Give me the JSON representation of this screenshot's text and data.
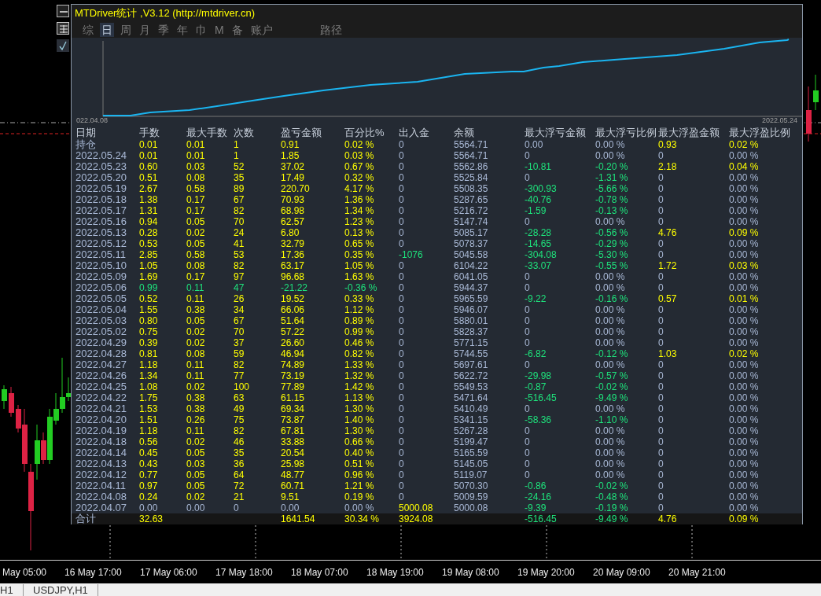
{
  "window": {
    "title": "MTDriver统计 ,V3.12 (http://mtdriver.cn)"
  },
  "tabs": [
    {
      "label": "综",
      "selected": false
    },
    {
      "label": "日",
      "selected": true
    },
    {
      "label": "周",
      "selected": false
    },
    {
      "label": "月",
      "selected": false
    },
    {
      "label": "季",
      "selected": false
    },
    {
      "label": "年",
      "selected": false
    },
    {
      "label": "巾",
      "selected": false
    },
    {
      "label": "M",
      "selected": false
    },
    {
      "label": "备",
      "selected": false
    },
    {
      "label": "账户",
      "selected": false
    },
    {
      "label": "路径",
      "selected": false
    }
  ],
  "equity_chart": {
    "start_label": "022.04.08",
    "end_label": "2022.05.24"
  },
  "table": {
    "columns": [
      "日期",
      "手数",
      "最大手数",
      "次数",
      "盈亏金额",
      "百分比%",
      "出入金",
      "余额",
      "最大浮亏金额",
      "最大浮亏比例",
      "最大浮盈金额",
      "最大浮盈比例"
    ],
    "rows": [
      {
        "cells": [
          {
            "text": "持仓",
            "color": "#a9b9d6"
          },
          {
            "text": "0.01",
            "color": "#ffff00"
          },
          {
            "text": "0.01",
            "color": "#ffff00"
          },
          {
            "text": "1",
            "color": "#ffff00"
          },
          {
            "text": "0.91",
            "color": "#ffff00"
          },
          {
            "text": "0.02 %",
            "color": "#ffff00"
          },
          {
            "text": "0",
            "color": "#a9b9d6"
          },
          {
            "text": "5564.71",
            "color": "#a9b9d6"
          },
          {
            "text": "0.00",
            "color": "#a9b9d6"
          },
          {
            "text": "0.00 %",
            "color": "#a9b9d6"
          },
          {
            "text": "0.93",
            "color": "#ffff00"
          },
          {
            "text": "0.02 %",
            "color": "#ffff00"
          }
        ]
      },
      {
        "cells": [
          {
            "text": "2022.05.24",
            "color": "#a9b9d6"
          },
          {
            "text": "0.01",
            "color": "#ffff00"
          },
          {
            "text": "0.01",
            "color": "#ffff00"
          },
          {
            "text": "1",
            "color": "#ffff00"
          },
          {
            "text": "1.85",
            "color": "#ffff00"
          },
          {
            "text": "0.03 %",
            "color": "#ffff00"
          },
          {
            "text": "0",
            "color": "#a9b9d6"
          },
          {
            "text": "5564.71",
            "color": "#a9b9d6"
          },
          {
            "text": "0",
            "color": "#a9b9d6"
          },
          {
            "text": "0.00 %",
            "color": "#a9b9d6"
          },
          {
            "text": "0",
            "color": "#a9b9d6"
          },
          {
            "text": "0.00 %",
            "color": "#a9b9d6"
          }
        ]
      },
      {
        "cells": [
          {
            "text": "2022.05.23",
            "color": "#a9b9d6"
          },
          {
            "text": "0.60",
            "color": "#ffff00"
          },
          {
            "text": "0.03",
            "color": "#ffff00"
          },
          {
            "text": "52",
            "color": "#ffff00"
          },
          {
            "text": "37.02",
            "color": "#ffff00"
          },
          {
            "text": "0.67 %",
            "color": "#ffff00"
          },
          {
            "text": "0",
            "color": "#a9b9d6"
          },
          {
            "text": "5562.86",
            "color": "#a9b9d6"
          },
          {
            "text": "-10.81",
            "color": "#1ee37c"
          },
          {
            "text": "-0.20 %",
            "color": "#1ee37c"
          },
          {
            "text": "2.18",
            "color": "#ffff00"
          },
          {
            "text": "0.04 %",
            "color": "#ffff00"
          }
        ]
      },
      {
        "cells": [
          {
            "text": "2022.05.20",
            "color": "#a9b9d6"
          },
          {
            "text": "0.51",
            "color": "#ffff00"
          },
          {
            "text": "0.08",
            "color": "#ffff00"
          },
          {
            "text": "35",
            "color": "#ffff00"
          },
          {
            "text": "17.49",
            "color": "#ffff00"
          },
          {
            "text": "0.32 %",
            "color": "#ffff00"
          },
          {
            "text": "0",
            "color": "#a9b9d6"
          },
          {
            "text": "5525.84",
            "color": "#a9b9d6"
          },
          {
            "text": "0",
            "color": "#a9b9d6"
          },
          {
            "text": "-1.31 %",
            "color": "#1ee37c"
          },
          {
            "text": "0",
            "color": "#a9b9d6"
          },
          {
            "text": "0.00 %",
            "color": "#a9b9d6"
          }
        ]
      },
      {
        "cells": [
          {
            "text": "2022.05.19",
            "color": "#a9b9d6"
          },
          {
            "text": "2.67",
            "color": "#ffff00"
          },
          {
            "text": "0.58",
            "color": "#ffff00"
          },
          {
            "text": "89",
            "color": "#ffff00"
          },
          {
            "text": "220.70",
            "color": "#ffff00"
          },
          {
            "text": "4.17 %",
            "color": "#ffff00"
          },
          {
            "text": "0",
            "color": "#a9b9d6"
          },
          {
            "text": "5508.35",
            "color": "#a9b9d6"
          },
          {
            "text": "-300.93",
            "color": "#1ee37c"
          },
          {
            "text": "-5.66 %",
            "color": "#1ee37c"
          },
          {
            "text": "0",
            "color": "#a9b9d6"
          },
          {
            "text": "0.00 %",
            "color": "#a9b9d6"
          }
        ]
      },
      {
        "cells": [
          {
            "text": "2022.05.18",
            "color": "#a9b9d6"
          },
          {
            "text": "1.38",
            "color": "#ffff00"
          },
          {
            "text": "0.17",
            "color": "#ffff00"
          },
          {
            "text": "67",
            "color": "#ffff00"
          },
          {
            "text": "70.93",
            "color": "#ffff00"
          },
          {
            "text": "1.36 %",
            "color": "#ffff00"
          },
          {
            "text": "0",
            "color": "#a9b9d6"
          },
          {
            "text": "5287.65",
            "color": "#a9b9d6"
          },
          {
            "text": "-40.76",
            "color": "#1ee37c"
          },
          {
            "text": "-0.78 %",
            "color": "#1ee37c"
          },
          {
            "text": "0",
            "color": "#a9b9d6"
          },
          {
            "text": "0.00 %",
            "color": "#a9b9d6"
          }
        ]
      },
      {
        "cells": [
          {
            "text": "2022.05.17",
            "color": "#a9b9d6"
          },
          {
            "text": "1.31",
            "color": "#ffff00"
          },
          {
            "text": "0.17",
            "color": "#ffff00"
          },
          {
            "text": "82",
            "color": "#ffff00"
          },
          {
            "text": "68.98",
            "color": "#ffff00"
          },
          {
            "text": "1.34 %",
            "color": "#ffff00"
          },
          {
            "text": "0",
            "color": "#a9b9d6"
          },
          {
            "text": "5216.72",
            "color": "#a9b9d6"
          },
          {
            "text": "-1.59",
            "color": "#1ee37c"
          },
          {
            "text": "-0.13 %",
            "color": "#1ee37c"
          },
          {
            "text": "0",
            "color": "#a9b9d6"
          },
          {
            "text": "0.00 %",
            "color": "#a9b9d6"
          }
        ]
      },
      {
        "cells": [
          {
            "text": "2022.05.16",
            "color": "#a9b9d6"
          },
          {
            "text": "0.94",
            "color": "#ffff00"
          },
          {
            "text": "0.05",
            "color": "#ffff00"
          },
          {
            "text": "70",
            "color": "#ffff00"
          },
          {
            "text": "62.57",
            "color": "#ffff00"
          },
          {
            "text": "1.23 %",
            "color": "#ffff00"
          },
          {
            "text": "0",
            "color": "#a9b9d6"
          },
          {
            "text": "5147.74",
            "color": "#a9b9d6"
          },
          {
            "text": "0",
            "color": "#a9b9d6"
          },
          {
            "text": "0.00 %",
            "color": "#a9b9d6"
          },
          {
            "text": "0",
            "color": "#a9b9d6"
          },
          {
            "text": "0.00 %",
            "color": "#a9b9d6"
          }
        ]
      },
      {
        "cells": [
          {
            "text": "2022.05.13",
            "color": "#a9b9d6"
          },
          {
            "text": "0.28",
            "color": "#ffff00"
          },
          {
            "text": "0.02",
            "color": "#ffff00"
          },
          {
            "text": "24",
            "color": "#ffff00"
          },
          {
            "text": "6.80",
            "color": "#ffff00"
          },
          {
            "text": "0.13 %",
            "color": "#ffff00"
          },
          {
            "text": "0",
            "color": "#a9b9d6"
          },
          {
            "text": "5085.17",
            "color": "#a9b9d6"
          },
          {
            "text": "-28.28",
            "color": "#1ee37c"
          },
          {
            "text": "-0.56 %",
            "color": "#1ee37c"
          },
          {
            "text": "4.76",
            "color": "#ffff00"
          },
          {
            "text": "0.09 %",
            "color": "#ffff00"
          }
        ]
      },
      {
        "cells": [
          {
            "text": "2022.05.12",
            "color": "#a9b9d6"
          },
          {
            "text": "0.53",
            "color": "#ffff00"
          },
          {
            "text": "0.05",
            "color": "#ffff00"
          },
          {
            "text": "41",
            "color": "#ffff00"
          },
          {
            "text": "32.79",
            "color": "#ffff00"
          },
          {
            "text": "0.65 %",
            "color": "#ffff00"
          },
          {
            "text": "0",
            "color": "#a9b9d6"
          },
          {
            "text": "5078.37",
            "color": "#a9b9d6"
          },
          {
            "text": "-14.65",
            "color": "#1ee37c"
          },
          {
            "text": "-0.29 %",
            "color": "#1ee37c"
          },
          {
            "text": "0",
            "color": "#a9b9d6"
          },
          {
            "text": "0.00 %",
            "color": "#a9b9d6"
          }
        ]
      },
      {
        "cells": [
          {
            "text": "2022.05.11",
            "color": "#a9b9d6"
          },
          {
            "text": "2.85",
            "color": "#ffff00"
          },
          {
            "text": "0.58",
            "color": "#ffff00"
          },
          {
            "text": "53",
            "color": "#ffff00"
          },
          {
            "text": "17.36",
            "color": "#ffff00"
          },
          {
            "text": "0.35 %",
            "color": "#ffff00"
          },
          {
            "text": "-1076",
            "color": "#1ee37c"
          },
          {
            "text": "5045.58",
            "color": "#a9b9d6"
          },
          {
            "text": "-304.08",
            "color": "#1ee37c"
          },
          {
            "text": "-5.30 %",
            "color": "#1ee37c"
          },
          {
            "text": "0",
            "color": "#a9b9d6"
          },
          {
            "text": "0.00 %",
            "color": "#a9b9d6"
          }
        ]
      },
      {
        "cells": [
          {
            "text": "2022.05.10",
            "color": "#a9b9d6"
          },
          {
            "text": "1.05",
            "color": "#ffff00"
          },
          {
            "text": "0.08",
            "color": "#ffff00"
          },
          {
            "text": "82",
            "color": "#ffff00"
          },
          {
            "text": "63.17",
            "color": "#ffff00"
          },
          {
            "text": "1.05 %",
            "color": "#ffff00"
          },
          {
            "text": "0",
            "color": "#a9b9d6"
          },
          {
            "text": "6104.22",
            "color": "#a9b9d6"
          },
          {
            "text": "-33.07",
            "color": "#1ee37c"
          },
          {
            "text": "-0.55 %",
            "color": "#1ee37c"
          },
          {
            "text": "1.72",
            "color": "#ffff00"
          },
          {
            "text": "0.03 %",
            "color": "#ffff00"
          }
        ]
      },
      {
        "cells": [
          {
            "text": "2022.05.09",
            "color": "#a9b9d6"
          },
          {
            "text": "1.69",
            "color": "#ffff00"
          },
          {
            "text": "0.17",
            "color": "#ffff00"
          },
          {
            "text": "97",
            "color": "#ffff00"
          },
          {
            "text": "96.68",
            "color": "#ffff00"
          },
          {
            "text": "1.63 %",
            "color": "#ffff00"
          },
          {
            "text": "0",
            "color": "#a9b9d6"
          },
          {
            "text": "6041.05",
            "color": "#a9b9d6"
          },
          {
            "text": "0",
            "color": "#a9b9d6"
          },
          {
            "text": "0.00 %",
            "color": "#a9b9d6"
          },
          {
            "text": "0",
            "color": "#a9b9d6"
          },
          {
            "text": "0.00 %",
            "color": "#a9b9d6"
          }
        ]
      },
      {
        "cells": [
          {
            "text": "2022.05.06",
            "color": "#a9b9d6"
          },
          {
            "text": "0.99",
            "color": "#1ee37c"
          },
          {
            "text": "0.11",
            "color": "#1ee37c"
          },
          {
            "text": "47",
            "color": "#1ee37c"
          },
          {
            "text": "-21.22",
            "color": "#1ee37c"
          },
          {
            "text": "-0.36 %",
            "color": "#1ee37c"
          },
          {
            "text": "0",
            "color": "#a9b9d6"
          },
          {
            "text": "5944.37",
            "color": "#a9b9d6"
          },
          {
            "text": "0",
            "color": "#a9b9d6"
          },
          {
            "text": "0.00 %",
            "color": "#a9b9d6"
          },
          {
            "text": "0",
            "color": "#a9b9d6"
          },
          {
            "text": "0.00 %",
            "color": "#a9b9d6"
          }
        ]
      },
      {
        "cells": [
          {
            "text": "2022.05.05",
            "color": "#a9b9d6"
          },
          {
            "text": "0.52",
            "color": "#ffff00"
          },
          {
            "text": "0.11",
            "color": "#ffff00"
          },
          {
            "text": "26",
            "color": "#ffff00"
          },
          {
            "text": "19.52",
            "color": "#ffff00"
          },
          {
            "text": "0.33 %",
            "color": "#ffff00"
          },
          {
            "text": "0",
            "color": "#a9b9d6"
          },
          {
            "text": "5965.59",
            "color": "#a9b9d6"
          },
          {
            "text": "-9.22",
            "color": "#1ee37c"
          },
          {
            "text": "-0.16 %",
            "color": "#1ee37c"
          },
          {
            "text": "0.57",
            "color": "#ffff00"
          },
          {
            "text": "0.01 %",
            "color": "#ffff00"
          }
        ]
      },
      {
        "cells": [
          {
            "text": "2022.05.04",
            "color": "#a9b9d6"
          },
          {
            "text": "1.55",
            "color": "#ffff00"
          },
          {
            "text": "0.38",
            "color": "#ffff00"
          },
          {
            "text": "34",
            "color": "#ffff00"
          },
          {
            "text": "66.06",
            "color": "#ffff00"
          },
          {
            "text": "1.12 %",
            "color": "#ffff00"
          },
          {
            "text": "0",
            "color": "#a9b9d6"
          },
          {
            "text": "5946.07",
            "color": "#a9b9d6"
          },
          {
            "text": "0",
            "color": "#a9b9d6"
          },
          {
            "text": "0.00 %",
            "color": "#a9b9d6"
          },
          {
            "text": "0",
            "color": "#a9b9d6"
          },
          {
            "text": "0.00 %",
            "color": "#a9b9d6"
          }
        ]
      },
      {
        "cells": [
          {
            "text": "2022.05.03",
            "color": "#a9b9d6"
          },
          {
            "text": "0.80",
            "color": "#ffff00"
          },
          {
            "text": "0.05",
            "color": "#ffff00"
          },
          {
            "text": "67",
            "color": "#ffff00"
          },
          {
            "text": "51.64",
            "color": "#ffff00"
          },
          {
            "text": "0.89 %",
            "color": "#ffff00"
          },
          {
            "text": "0",
            "color": "#a9b9d6"
          },
          {
            "text": "5880.01",
            "color": "#a9b9d6"
          },
          {
            "text": "0",
            "color": "#a9b9d6"
          },
          {
            "text": "0.00 %",
            "color": "#a9b9d6"
          },
          {
            "text": "0",
            "color": "#a9b9d6"
          },
          {
            "text": "0.00 %",
            "color": "#a9b9d6"
          }
        ]
      },
      {
        "cells": [
          {
            "text": "2022.05.02",
            "color": "#a9b9d6"
          },
          {
            "text": "0.75",
            "color": "#ffff00"
          },
          {
            "text": "0.02",
            "color": "#ffff00"
          },
          {
            "text": "70",
            "color": "#ffff00"
          },
          {
            "text": "57.22",
            "color": "#ffff00"
          },
          {
            "text": "0.99 %",
            "color": "#ffff00"
          },
          {
            "text": "0",
            "color": "#a9b9d6"
          },
          {
            "text": "5828.37",
            "color": "#a9b9d6"
          },
          {
            "text": "0",
            "color": "#a9b9d6"
          },
          {
            "text": "0.00 %",
            "color": "#a9b9d6"
          },
          {
            "text": "0",
            "color": "#a9b9d6"
          },
          {
            "text": "0.00 %",
            "color": "#a9b9d6"
          }
        ]
      },
      {
        "cells": [
          {
            "text": "2022.04.29",
            "color": "#a9b9d6"
          },
          {
            "text": "0.39",
            "color": "#ffff00"
          },
          {
            "text": "0.02",
            "color": "#ffff00"
          },
          {
            "text": "37",
            "color": "#ffff00"
          },
          {
            "text": "26.60",
            "color": "#ffff00"
          },
          {
            "text": "0.46 %",
            "color": "#ffff00"
          },
          {
            "text": "0",
            "color": "#a9b9d6"
          },
          {
            "text": "5771.15",
            "color": "#a9b9d6"
          },
          {
            "text": "0",
            "color": "#a9b9d6"
          },
          {
            "text": "0.00 %",
            "color": "#a9b9d6"
          },
          {
            "text": "0",
            "color": "#a9b9d6"
          },
          {
            "text": "0.00 %",
            "color": "#a9b9d6"
          }
        ]
      },
      {
        "cells": [
          {
            "text": "2022.04.28",
            "color": "#a9b9d6"
          },
          {
            "text": "0.81",
            "color": "#ffff00"
          },
          {
            "text": "0.08",
            "color": "#ffff00"
          },
          {
            "text": "59",
            "color": "#ffff00"
          },
          {
            "text": "46.94",
            "color": "#ffff00"
          },
          {
            "text": "0.82 %",
            "color": "#ffff00"
          },
          {
            "text": "0",
            "color": "#a9b9d6"
          },
          {
            "text": "5744.55",
            "color": "#a9b9d6"
          },
          {
            "text": "-6.82",
            "color": "#1ee37c"
          },
          {
            "text": "-0.12 %",
            "color": "#1ee37c"
          },
          {
            "text": "1.03",
            "color": "#ffff00"
          },
          {
            "text": "0.02 %",
            "color": "#ffff00"
          }
        ]
      },
      {
        "cells": [
          {
            "text": "2022.04.27",
            "color": "#a9b9d6"
          },
          {
            "text": "1.18",
            "color": "#ffff00"
          },
          {
            "text": "0.11",
            "color": "#ffff00"
          },
          {
            "text": "82",
            "color": "#ffff00"
          },
          {
            "text": "74.89",
            "color": "#ffff00"
          },
          {
            "text": "1.33 %",
            "color": "#ffff00"
          },
          {
            "text": "0",
            "color": "#a9b9d6"
          },
          {
            "text": "5697.61",
            "color": "#a9b9d6"
          },
          {
            "text": "0",
            "color": "#a9b9d6"
          },
          {
            "text": "0.00 %",
            "color": "#a9b9d6"
          },
          {
            "text": "0",
            "color": "#a9b9d6"
          },
          {
            "text": "0.00 %",
            "color": "#a9b9d6"
          }
        ]
      },
      {
        "cells": [
          {
            "text": "2022.04.26",
            "color": "#a9b9d6"
          },
          {
            "text": "1.34",
            "color": "#ffff00"
          },
          {
            "text": "0.11",
            "color": "#ffff00"
          },
          {
            "text": "77",
            "color": "#ffff00"
          },
          {
            "text": "73.19",
            "color": "#ffff00"
          },
          {
            "text": "1.32 %",
            "color": "#ffff00"
          },
          {
            "text": "0",
            "color": "#a9b9d6"
          },
          {
            "text": "5622.72",
            "color": "#a9b9d6"
          },
          {
            "text": "-29.98",
            "color": "#1ee37c"
          },
          {
            "text": "-0.57 %",
            "color": "#1ee37c"
          },
          {
            "text": "0",
            "color": "#a9b9d6"
          },
          {
            "text": "0.00 %",
            "color": "#a9b9d6"
          }
        ]
      },
      {
        "cells": [
          {
            "text": "2022.04.25",
            "color": "#a9b9d6"
          },
          {
            "text": "1.08",
            "color": "#ffff00"
          },
          {
            "text": "0.02",
            "color": "#ffff00"
          },
          {
            "text": "100",
            "color": "#ffff00"
          },
          {
            "text": "77.89",
            "color": "#ffff00"
          },
          {
            "text": "1.42 %",
            "color": "#ffff00"
          },
          {
            "text": "0",
            "color": "#a9b9d6"
          },
          {
            "text": "5549.53",
            "color": "#a9b9d6"
          },
          {
            "text": "-0.87",
            "color": "#1ee37c"
          },
          {
            "text": "-0.02 %",
            "color": "#1ee37c"
          },
          {
            "text": "0",
            "color": "#a9b9d6"
          },
          {
            "text": "0.00 %",
            "color": "#a9b9d6"
          }
        ]
      },
      {
        "cells": [
          {
            "text": "2022.04.22",
            "color": "#a9b9d6"
          },
          {
            "text": "1.75",
            "color": "#ffff00"
          },
          {
            "text": "0.38",
            "color": "#ffff00"
          },
          {
            "text": "63",
            "color": "#ffff00"
          },
          {
            "text": "61.15",
            "color": "#ffff00"
          },
          {
            "text": "1.13 %",
            "color": "#ffff00"
          },
          {
            "text": "0",
            "color": "#a9b9d6"
          },
          {
            "text": "5471.64",
            "color": "#a9b9d6"
          },
          {
            "text": "-516.45",
            "color": "#1ee37c"
          },
          {
            "text": "-9.49 %",
            "color": "#1ee37c"
          },
          {
            "text": "0",
            "color": "#a9b9d6"
          },
          {
            "text": "0.00 %",
            "color": "#a9b9d6"
          }
        ]
      },
      {
        "cells": [
          {
            "text": "2022.04.21",
            "color": "#a9b9d6"
          },
          {
            "text": "1.53",
            "color": "#ffff00"
          },
          {
            "text": "0.38",
            "color": "#ffff00"
          },
          {
            "text": "49",
            "color": "#ffff00"
          },
          {
            "text": "69.34",
            "color": "#ffff00"
          },
          {
            "text": "1.30 %",
            "color": "#ffff00"
          },
          {
            "text": "0",
            "color": "#a9b9d6"
          },
          {
            "text": "5410.49",
            "color": "#a9b9d6"
          },
          {
            "text": "0",
            "color": "#a9b9d6"
          },
          {
            "text": "0.00 %",
            "color": "#a9b9d6"
          },
          {
            "text": "0",
            "color": "#a9b9d6"
          },
          {
            "text": "0.00 %",
            "color": "#a9b9d6"
          }
        ]
      },
      {
        "cells": [
          {
            "text": "2022.04.20",
            "color": "#a9b9d6"
          },
          {
            "text": "1.51",
            "color": "#ffff00"
          },
          {
            "text": "0.26",
            "color": "#ffff00"
          },
          {
            "text": "75",
            "color": "#ffff00"
          },
          {
            "text": "73.87",
            "color": "#ffff00"
          },
          {
            "text": "1.40 %",
            "color": "#ffff00"
          },
          {
            "text": "0",
            "color": "#a9b9d6"
          },
          {
            "text": "5341.15",
            "color": "#a9b9d6"
          },
          {
            "text": "-58.36",
            "color": "#1ee37c"
          },
          {
            "text": "-1.10 %",
            "color": "#1ee37c"
          },
          {
            "text": "0",
            "color": "#a9b9d6"
          },
          {
            "text": "0.00 %",
            "color": "#a9b9d6"
          }
        ]
      },
      {
        "cells": [
          {
            "text": "2022.04.19",
            "color": "#a9b9d6"
          },
          {
            "text": "1.18",
            "color": "#ffff00"
          },
          {
            "text": "0.11",
            "color": "#ffff00"
          },
          {
            "text": "82",
            "color": "#ffff00"
          },
          {
            "text": "67.81",
            "color": "#ffff00"
          },
          {
            "text": "1.30 %",
            "color": "#ffff00"
          },
          {
            "text": "0",
            "color": "#a9b9d6"
          },
          {
            "text": "5267.28",
            "color": "#a9b9d6"
          },
          {
            "text": "0",
            "color": "#a9b9d6"
          },
          {
            "text": "0.00 %",
            "color": "#a9b9d6"
          },
          {
            "text": "0",
            "color": "#a9b9d6"
          },
          {
            "text": "0.00 %",
            "color": "#a9b9d6"
          }
        ]
      },
      {
        "cells": [
          {
            "text": "2022.04.18",
            "color": "#a9b9d6"
          },
          {
            "text": "0.56",
            "color": "#ffff00"
          },
          {
            "text": "0.02",
            "color": "#ffff00"
          },
          {
            "text": "46",
            "color": "#ffff00"
          },
          {
            "text": "33.88",
            "color": "#ffff00"
          },
          {
            "text": "0.66 %",
            "color": "#ffff00"
          },
          {
            "text": "0",
            "color": "#a9b9d6"
          },
          {
            "text": "5199.47",
            "color": "#a9b9d6"
          },
          {
            "text": "0",
            "color": "#a9b9d6"
          },
          {
            "text": "0.00 %",
            "color": "#a9b9d6"
          },
          {
            "text": "0",
            "color": "#a9b9d6"
          },
          {
            "text": "0.00 %",
            "color": "#a9b9d6"
          }
        ]
      },
      {
        "cells": [
          {
            "text": "2022.04.14",
            "color": "#a9b9d6"
          },
          {
            "text": "0.45",
            "color": "#ffff00"
          },
          {
            "text": "0.05",
            "color": "#ffff00"
          },
          {
            "text": "35",
            "color": "#ffff00"
          },
          {
            "text": "20.54",
            "color": "#ffff00"
          },
          {
            "text": "0.40 %",
            "color": "#ffff00"
          },
          {
            "text": "0",
            "color": "#a9b9d6"
          },
          {
            "text": "5165.59",
            "color": "#a9b9d6"
          },
          {
            "text": "0",
            "color": "#a9b9d6"
          },
          {
            "text": "0.00 %",
            "color": "#a9b9d6"
          },
          {
            "text": "0",
            "color": "#a9b9d6"
          },
          {
            "text": "0.00 %",
            "color": "#a9b9d6"
          }
        ]
      },
      {
        "cells": [
          {
            "text": "2022.04.13",
            "color": "#a9b9d6"
          },
          {
            "text": "0.43",
            "color": "#ffff00"
          },
          {
            "text": "0.03",
            "color": "#ffff00"
          },
          {
            "text": "36",
            "color": "#ffff00"
          },
          {
            "text": "25.98",
            "color": "#ffff00"
          },
          {
            "text": "0.51 %",
            "color": "#ffff00"
          },
          {
            "text": "0",
            "color": "#a9b9d6"
          },
          {
            "text": "5145.05",
            "color": "#a9b9d6"
          },
          {
            "text": "0",
            "color": "#a9b9d6"
          },
          {
            "text": "0.00 %",
            "color": "#a9b9d6"
          },
          {
            "text": "0",
            "color": "#a9b9d6"
          },
          {
            "text": "0.00 %",
            "color": "#a9b9d6"
          }
        ]
      },
      {
        "cells": [
          {
            "text": "2022.04.12",
            "color": "#a9b9d6"
          },
          {
            "text": "0.77",
            "color": "#ffff00"
          },
          {
            "text": "0.05",
            "color": "#ffff00"
          },
          {
            "text": "64",
            "color": "#ffff00"
          },
          {
            "text": "48.77",
            "color": "#ffff00"
          },
          {
            "text": "0.96 %",
            "color": "#ffff00"
          },
          {
            "text": "0",
            "color": "#a9b9d6"
          },
          {
            "text": "5119.07",
            "color": "#a9b9d6"
          },
          {
            "text": "0",
            "color": "#a9b9d6"
          },
          {
            "text": "0.00 %",
            "color": "#a9b9d6"
          },
          {
            "text": "0",
            "color": "#a9b9d6"
          },
          {
            "text": "0.00 %",
            "color": "#a9b9d6"
          }
        ]
      },
      {
        "cells": [
          {
            "text": "2022.04.11",
            "color": "#a9b9d6"
          },
          {
            "text": "0.97",
            "color": "#ffff00"
          },
          {
            "text": "0.05",
            "color": "#ffff00"
          },
          {
            "text": "72",
            "color": "#ffff00"
          },
          {
            "text": "60.71",
            "color": "#ffff00"
          },
          {
            "text": "1.21 %",
            "color": "#ffff00"
          },
          {
            "text": "0",
            "color": "#a9b9d6"
          },
          {
            "text": "5070.30",
            "color": "#a9b9d6"
          },
          {
            "text": "-0.86",
            "color": "#1ee37c"
          },
          {
            "text": "-0.02 %",
            "color": "#1ee37c"
          },
          {
            "text": "0",
            "color": "#a9b9d6"
          },
          {
            "text": "0.00 %",
            "color": "#a9b9d6"
          }
        ]
      },
      {
        "cells": [
          {
            "text": "2022.04.08",
            "color": "#a9b9d6"
          },
          {
            "text": "0.24",
            "color": "#ffff00"
          },
          {
            "text": "0.02",
            "color": "#ffff00"
          },
          {
            "text": "21",
            "color": "#ffff00"
          },
          {
            "text": "9.51",
            "color": "#ffff00"
          },
          {
            "text": "0.19 %",
            "color": "#ffff00"
          },
          {
            "text": "0",
            "color": "#a9b9d6"
          },
          {
            "text": "5009.59",
            "color": "#a9b9d6"
          },
          {
            "text": "-24.16",
            "color": "#1ee37c"
          },
          {
            "text": "-0.48 %",
            "color": "#1ee37c"
          },
          {
            "text": "0",
            "color": "#a9b9d6"
          },
          {
            "text": "0.00 %",
            "color": "#a9b9d6"
          }
        ]
      },
      {
        "cells": [
          {
            "text": "2022.04.07",
            "color": "#a9b9d6"
          },
          {
            "text": "0.00",
            "color": "#a9b9d6"
          },
          {
            "text": "0.00",
            "color": "#a9b9d6"
          },
          {
            "text": "0",
            "color": "#a9b9d6"
          },
          {
            "text": "0.00",
            "color": "#a9b9d6"
          },
          {
            "text": "0.00 %",
            "color": "#a9b9d6"
          },
          {
            "text": "5000.08",
            "color": "#ffff00"
          },
          {
            "text": "5000.08",
            "color": "#a9b9d6"
          },
          {
            "text": "-9.39",
            "color": "#1ee37c"
          },
          {
            "text": "-0.19 %",
            "color": "#1ee37c"
          },
          {
            "text": "0",
            "color": "#a9b9d6"
          },
          {
            "text": "0.00 %",
            "color": "#a9b9d6"
          }
        ]
      }
    ],
    "total": {
      "cells": [
        {
          "text": "合计",
          "color": "#a9b9d6"
        },
        {
          "text": "32.63",
          "color": "#ffff00"
        },
        {},
        {},
        {
          "text": "1641.54",
          "color": "#ffff00"
        },
        {
          "text": "30.34 %",
          "color": "#ffff00"
        },
        {
          "text": "3924.08",
          "color": "#ffff00"
        },
        {},
        {
          "text": "-516.45",
          "color": "#1ee37c"
        },
        {
          "text": "-9.49 %",
          "color": "#1ee37c"
        },
        {
          "text": "4.76",
          "color": "#ffff00"
        },
        {
          "text": "0.09 %",
          "color": "#ffff00"
        }
      ]
    }
  },
  "time_axis": [
    "May 05:00",
    "16 May 17:00",
    "17 May 06:00",
    "17 May 18:00",
    "18 May 07:00",
    "18 May 19:00",
    "19 May 08:00",
    "19 May 20:00",
    "20 May 09:00",
    "20 May 21:00"
  ],
  "chart_tabs": [
    {
      "label": "H1"
    },
    {
      "label": "USDJPY,H1"
    }
  ]
}
